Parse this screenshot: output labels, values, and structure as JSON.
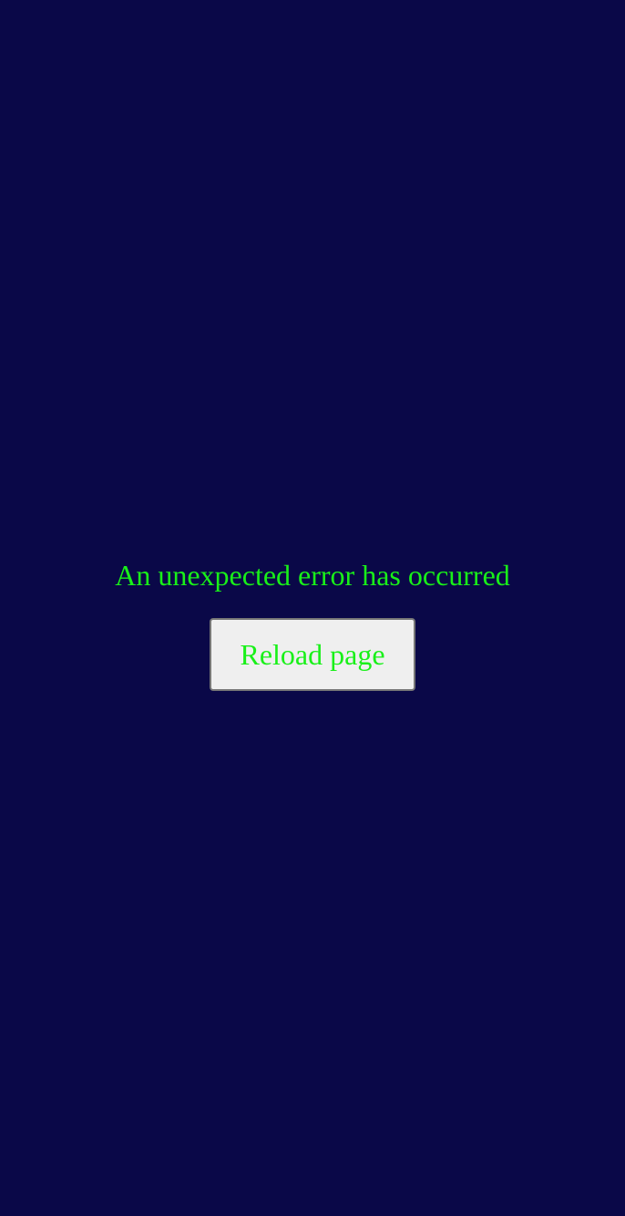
{
  "error": {
    "message": "An unexpected error has occurred",
    "reload_label": "Reload page"
  },
  "colors": {
    "background": "#0a0848",
    "text": "#19f019",
    "button_background": "#efefef",
    "button_border": "#767676"
  }
}
